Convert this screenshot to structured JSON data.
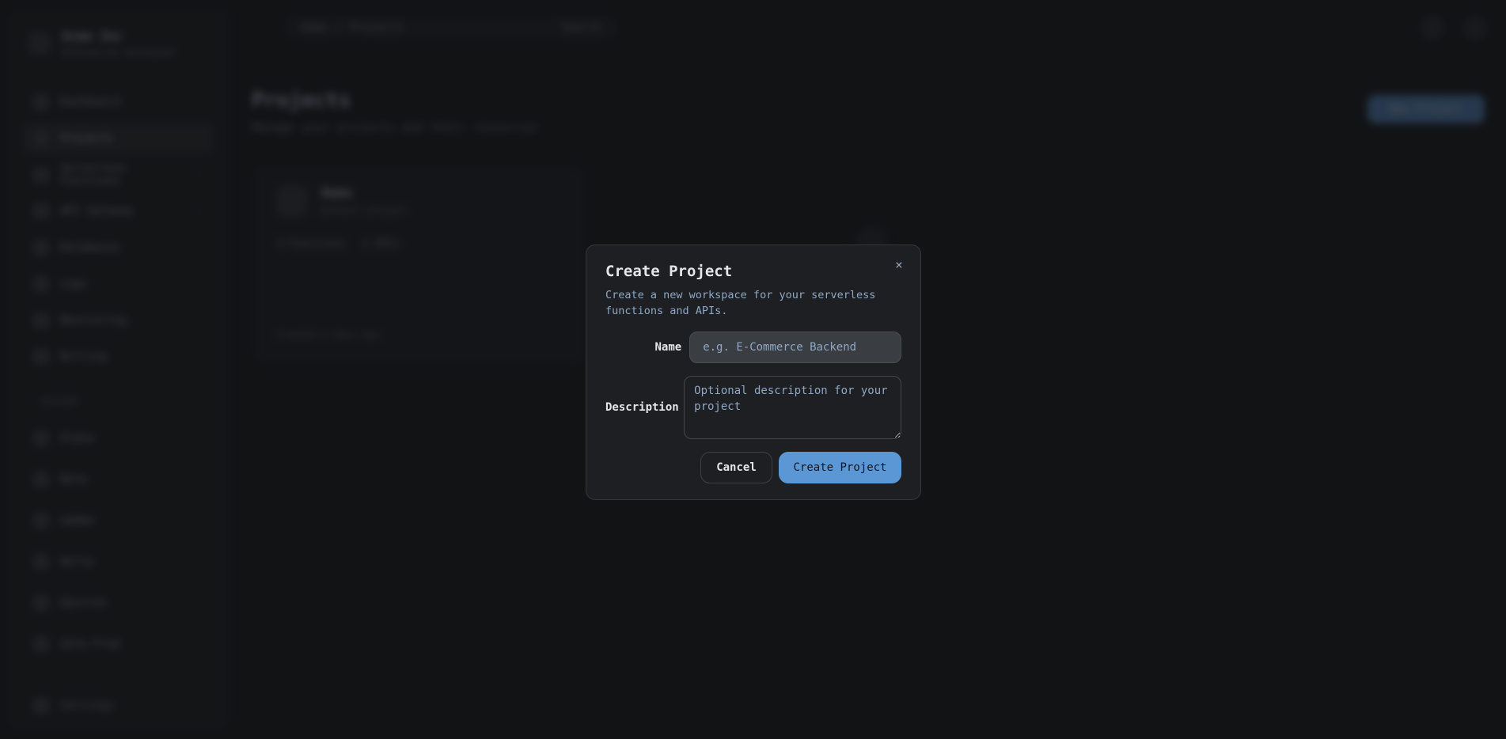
{
  "background": {
    "brand": {
      "name": "Acme Inc",
      "subtitle": "Enterprise workspace"
    },
    "nav": [
      {
        "label": "Dashboard",
        "icon": "grid-icon",
        "active": false
      },
      {
        "label": "Projects",
        "icon": "folder-icon",
        "active": true
      },
      {
        "label": "Serverless Functions",
        "icon": "lambda-icon",
        "active": false,
        "caret": "›"
      },
      {
        "label": "API Gateway",
        "icon": "plug-icon",
        "active": false,
        "caret": "›"
      },
      {
        "label": "Databases",
        "icon": "database-icon",
        "active": false
      },
      {
        "label": "Logs",
        "icon": "list-icon",
        "active": false
      },
      {
        "label": "Monitoring",
        "icon": "chart-icon",
        "active": false
      },
      {
        "label": "Billing",
        "icon": "card-icon",
        "active": false
      }
    ],
    "section_label": "RECENT",
    "recent": [
      {
        "label": "Alpha"
      },
      {
        "label": "Beta"
      },
      {
        "label": "Gamma"
      },
      {
        "label": "Delta"
      },
      {
        "label": "Epsilon"
      },
      {
        "label": "Zeta Prod"
      }
    ],
    "footer": "Settings",
    "breadcrumb": {
      "root": "Home",
      "current": "Projects",
      "search": "Search"
    },
    "page_title": "Projects",
    "page_subtitle": "Manage your projects and their resources",
    "new_button": "New Project",
    "card": {
      "name": "Demo",
      "subtitle": "Default project",
      "tags": [
        "3 Functions",
        "2 APIs"
      ],
      "footer": "Created 2 days ago"
    }
  },
  "modal": {
    "title": "Create Project",
    "description": "Create a new workspace for your serverless functions and APIs.",
    "close_icon": "×",
    "name_label": "Name",
    "name_placeholder": "e.g. E-Commerce Backend",
    "name_value": "",
    "description_label": "Description",
    "description_placeholder": "Optional description for your project",
    "description_value": "",
    "cancel_label": "Cancel",
    "create_label": "Create Project",
    "accent_color": "#5b97d5"
  }
}
